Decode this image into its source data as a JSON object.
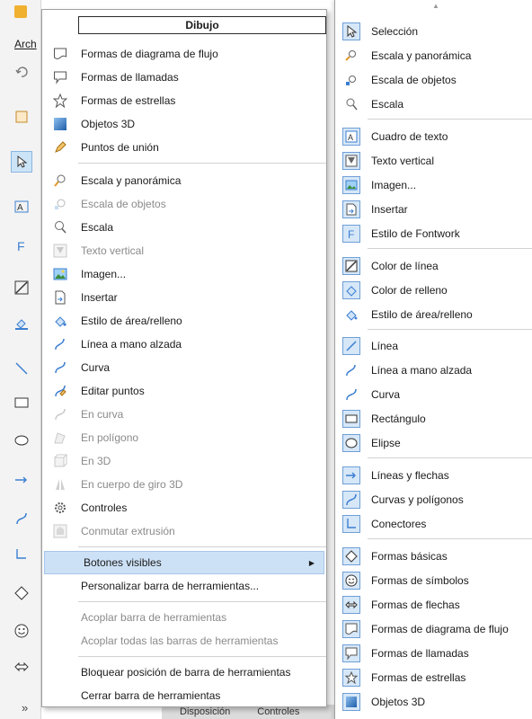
{
  "background_app": {
    "menu_fragment": "Arch",
    "more_label": "»",
    "bottom_tabs": [
      "Disposición",
      "Controles"
    ]
  },
  "context_menu": {
    "title": "Dibujo",
    "items": [
      {
        "label": "Formas de diagrama de flujo",
        "icon": "flowchart-shape-icon",
        "disabled": false
      },
      {
        "label": "Formas de llamadas",
        "icon": "callout-shape-icon",
        "disabled": false
      },
      {
        "label": "Formas de estrellas",
        "icon": "star-shape-icon",
        "disabled": false
      },
      {
        "label": "Objetos 3D",
        "icon": "cube-3d-icon",
        "disabled": false
      },
      {
        "label": "Puntos de unión",
        "icon": "glue-point-icon",
        "disabled": false
      },
      {
        "label": "Escala y panorámica",
        "icon": "zoom-pan-icon",
        "disabled": false
      },
      {
        "label": "Escala de objetos",
        "icon": "zoom-object-icon",
        "disabled": true
      },
      {
        "label": "Escala",
        "icon": "magnifier-icon",
        "disabled": false
      },
      {
        "label": "Texto vertical",
        "icon": "vertical-text-icon",
        "disabled": true
      },
      {
        "label": "Imagen...",
        "icon": "image-icon",
        "disabled": false
      },
      {
        "label": "Insertar",
        "icon": "insert-icon",
        "disabled": false
      },
      {
        "label": "Estilo de área/relleno",
        "icon": "area-style-icon",
        "disabled": false
      },
      {
        "label": "Línea a mano alzada",
        "icon": "freeform-line-icon",
        "disabled": false
      },
      {
        "label": "Curva",
        "icon": "curve-icon",
        "disabled": false
      },
      {
        "label": "Editar puntos",
        "icon": "edit-points-icon",
        "disabled": false
      },
      {
        "label": "En curva",
        "icon": "to-curve-icon",
        "disabled": true
      },
      {
        "label": "En polígono",
        "icon": "to-polygon-icon",
        "disabled": true
      },
      {
        "label": "En 3D",
        "icon": "to-3d-icon",
        "disabled": true
      },
      {
        "label": "En cuerpo de giro 3D",
        "icon": "rotation-3d-icon",
        "disabled": true
      },
      {
        "label": "Controles",
        "icon": "controls-gear-icon",
        "disabled": false
      },
      {
        "label": "Conmutar extrusión",
        "icon": "extrusion-icon",
        "disabled": true
      },
      {
        "label": "Botones visibles",
        "highlighted": true
      },
      {
        "label": "Personalizar barra de herramientas..."
      },
      {
        "label": "Acoplar barra de herramientas",
        "disabled": true
      },
      {
        "label": "Acoplar todas las barras de herramientas",
        "disabled": true
      },
      {
        "label": "Bloquear posición de barra de herramientas"
      },
      {
        "label": "Cerrar barra de herramientas"
      }
    ]
  },
  "submenu": {
    "items": [
      {
        "label": "Selección",
        "icon": "cursor-icon",
        "checked": true
      },
      {
        "label": "Escala y panorámica",
        "icon": "zoom-pan-icon",
        "checked": false
      },
      {
        "label": "Escala de objetos",
        "icon": "zoom-object-icon",
        "checked": false
      },
      {
        "label": "Escala",
        "icon": "magnifier-icon",
        "checked": false
      },
      {
        "label": "Cuadro de texto",
        "icon": "text-box-icon",
        "checked": true
      },
      {
        "label": "Texto vertical",
        "icon": "vertical-text-icon",
        "checked": true
      },
      {
        "label": "Imagen...",
        "icon": "image-icon",
        "checked": true
      },
      {
        "label": "Insertar",
        "icon": "insert-icon",
        "checked": true
      },
      {
        "label": "Estilo de Fontwork",
        "icon": "fontwork-icon",
        "checked": true
      },
      {
        "label": "Color de línea",
        "icon": "line-color-icon",
        "checked": true
      },
      {
        "label": "Color de relleno",
        "icon": "fill-color-icon",
        "checked": true
      },
      {
        "label": "Estilo de área/relleno",
        "icon": "area-style-icon",
        "checked": false
      },
      {
        "label": "Línea",
        "icon": "line-icon",
        "checked": true
      },
      {
        "label": "Línea a mano alzada",
        "icon": "freeform-line-icon",
        "checked": false
      },
      {
        "label": "Curva",
        "icon": "curve-icon",
        "checked": false
      },
      {
        "label": "Rectángulo",
        "icon": "rectangle-icon",
        "checked": true
      },
      {
        "label": "Elipse",
        "icon": "ellipse-icon",
        "checked": true
      },
      {
        "label": "Líneas y flechas",
        "icon": "arrow-line-icon",
        "checked": true
      },
      {
        "label": "Curvas y polígonos",
        "icon": "curves-polygons-icon",
        "checked": true
      },
      {
        "label": "Conectores",
        "icon": "connector-icon",
        "checked": true
      },
      {
        "label": "Formas básicas",
        "icon": "diamond-icon",
        "checked": true
      },
      {
        "label": "Formas de símbolos",
        "icon": "smiley-icon",
        "checked": true
      },
      {
        "label": "Formas de flechas",
        "icon": "double-arrow-icon",
        "checked": true
      },
      {
        "label": "Formas de diagrama de flujo",
        "icon": "flowchart-shape-icon",
        "checked": true
      },
      {
        "label": "Formas de llamadas",
        "icon": "callout-shape-icon",
        "checked": true
      },
      {
        "label": "Formas de estrellas",
        "icon": "star-shape-icon",
        "checked": true
      },
      {
        "label": "Objetos 3D",
        "icon": "cube-3d-icon",
        "checked": true
      }
    ]
  },
  "colors": {
    "accent": "#3c7fd1",
    "highlight": "#cde1f6",
    "check_bg": "#d6e7f8"
  }
}
